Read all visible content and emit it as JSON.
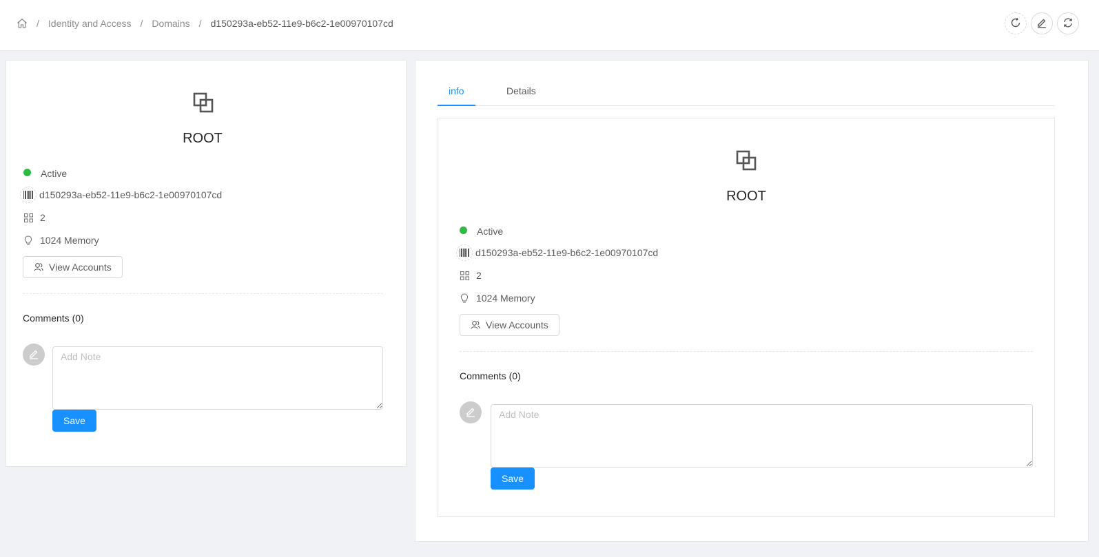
{
  "breadcrumb": {
    "home_icon": "home-icon",
    "items": [
      "Identity and Access",
      "Domains",
      "d150293a-eb52-11e9-b6c2-1e00970107cd"
    ]
  },
  "header_actions": [
    {
      "icon": "reload-icon",
      "name": "refresh-button"
    },
    {
      "icon": "edit-icon",
      "name": "edit-button"
    },
    {
      "icon": "sync-icon",
      "name": "sync-button"
    }
  ],
  "resource": {
    "icon": "block-icon",
    "name": "ROOT",
    "state": "Active",
    "state_color": "#2dbb43",
    "id": "d150293a-eb52-11e9-b6c2-1e00970107cd",
    "count": "2",
    "memory": "1024 Memory",
    "view_accounts_label": "View Accounts"
  },
  "comments": {
    "title": "Comments (0)",
    "placeholder": "Add Note",
    "save_label": "Save"
  },
  "tabs": {
    "items": [
      "info",
      "Details"
    ],
    "active": "info"
  },
  "colors": {
    "primary": "#1890ff",
    "background": "#f0f2f5"
  }
}
